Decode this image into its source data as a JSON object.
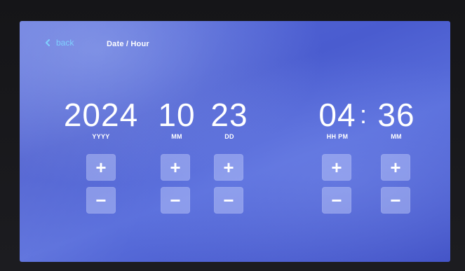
{
  "header": {
    "back_label": "back",
    "title": "Date / Hour"
  },
  "date": {
    "year": {
      "value": "2024",
      "unit": "YYYY"
    },
    "month": {
      "value": "10",
      "unit": "MM"
    },
    "day": {
      "value": "23",
      "unit": "DD"
    }
  },
  "time": {
    "hour": {
      "value": "04",
      "unit": "HH PM"
    },
    "separator": ":",
    "minute": {
      "value": "36",
      "unit": "MM"
    }
  },
  "controls": {
    "increment_symbol": "+",
    "decrement_symbol": "−"
  },
  "colors": {
    "accent": "#7fd0ff",
    "background": "#4a5ccf",
    "button": "#cdd7ff"
  }
}
